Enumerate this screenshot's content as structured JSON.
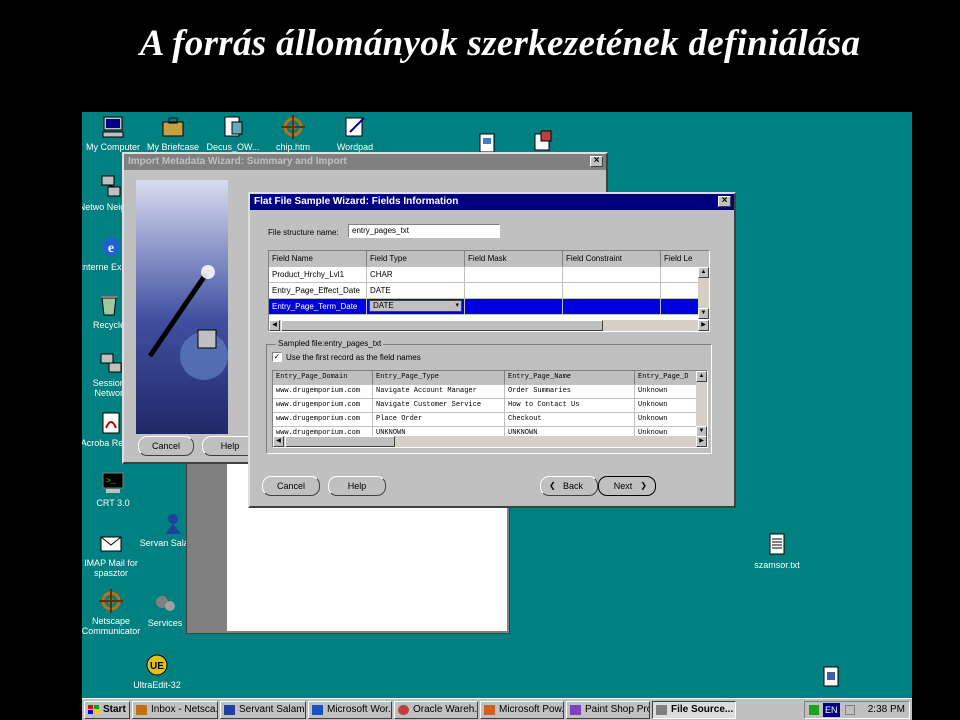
{
  "slide": {
    "title": "A forrás állományok szerkezetének definiálása"
  },
  "desktop_icons": [
    {
      "label": "My Computer"
    },
    {
      "label": "My Briefcase"
    },
    {
      "label": "Decus_OW..."
    },
    {
      "label": "chip.htm"
    },
    {
      "label": "Wordpad"
    },
    {
      "label": "Netwo Neighbor"
    },
    {
      "label": "Interne Explore"
    },
    {
      "label": "Recycle"
    },
    {
      "label": "Sessions Network"
    },
    {
      "label": "Acroba Reader"
    },
    {
      "label": "CRT 3.0"
    },
    {
      "label": "Servan Salaman"
    },
    {
      "label": "IMAP Mail for spasztor"
    },
    {
      "label": "Services"
    },
    {
      "label": "Netscape Communicator"
    },
    {
      "label": "UltraEdit-32"
    },
    {
      "label": "szamsor.txt"
    }
  ],
  "back_window": {
    "title": "Import Metadata Wizard: Summary and Import",
    "close": "×",
    "cancel_label": "Cancel",
    "help_label": "Help"
  },
  "wizard": {
    "title": "Flat File Sample Wizard: Fields Information",
    "close": "×",
    "structure_label": "File structure name:",
    "structure_value": "entry_pages_txt",
    "fields_columns": [
      "Field Name",
      "Field Type",
      "Field Mask",
      "Field Constraint",
      "Field Le"
    ],
    "fields_rows": [
      [
        "Product_Hrchy_Lvl1",
        "CHAR",
        "",
        "",
        ""
      ],
      [
        "Entry_Page_Effect_Date",
        "DATE",
        "",
        "",
        ""
      ],
      [
        "Entry_Page_Term_Date",
        "DATE",
        "",
        "",
        ""
      ]
    ],
    "sampled_label": "Sampled file:entry_pages_txt",
    "first_record_label": "Use the first record as the field names",
    "first_record_checked": "✓",
    "sample_columns": [
      "Entry_Page_Domain",
      "Entry_Page_Type",
      "Entry_Page_Name",
      "Entry_Page_D"
    ],
    "sample_rows": [
      [
        "www.drugemporium.com",
        "Navigate Account Manager",
        "Order Summaries",
        "Unknown"
      ],
      [
        "www.drugemporium.com",
        "Navigate Customer Service",
        "How to Contact Us",
        "Unknown"
      ],
      [
        "www.drugemporium.com",
        "Place Order",
        "Checkout",
        "Unknown"
      ],
      [
        "www.drugemporium.com",
        "UNKNOWN",
        "UNKNOWN",
        "Unknown"
      ]
    ],
    "cancel_label": "Cancel",
    "help_label": "Help",
    "back_label": "Back",
    "next_label": "Next"
  },
  "taskbar": {
    "start_label": "Start",
    "buttons": [
      {
        "label": "Inbox - Netsca..."
      },
      {
        "label": "Servant Salam..."
      },
      {
        "label": "Microsoft Wor..."
      },
      {
        "label": "Oracle Wareh..."
      },
      {
        "label": "Microsoft Pow..."
      },
      {
        "label": "Paint Shop Pro"
      },
      {
        "label": "File Source..."
      }
    ],
    "lang": "EN",
    "time": "2:38 PM"
  },
  "colors": {
    "desktop": "#008080",
    "titlebar_active": "#000080",
    "selection": "#0000e0"
  }
}
